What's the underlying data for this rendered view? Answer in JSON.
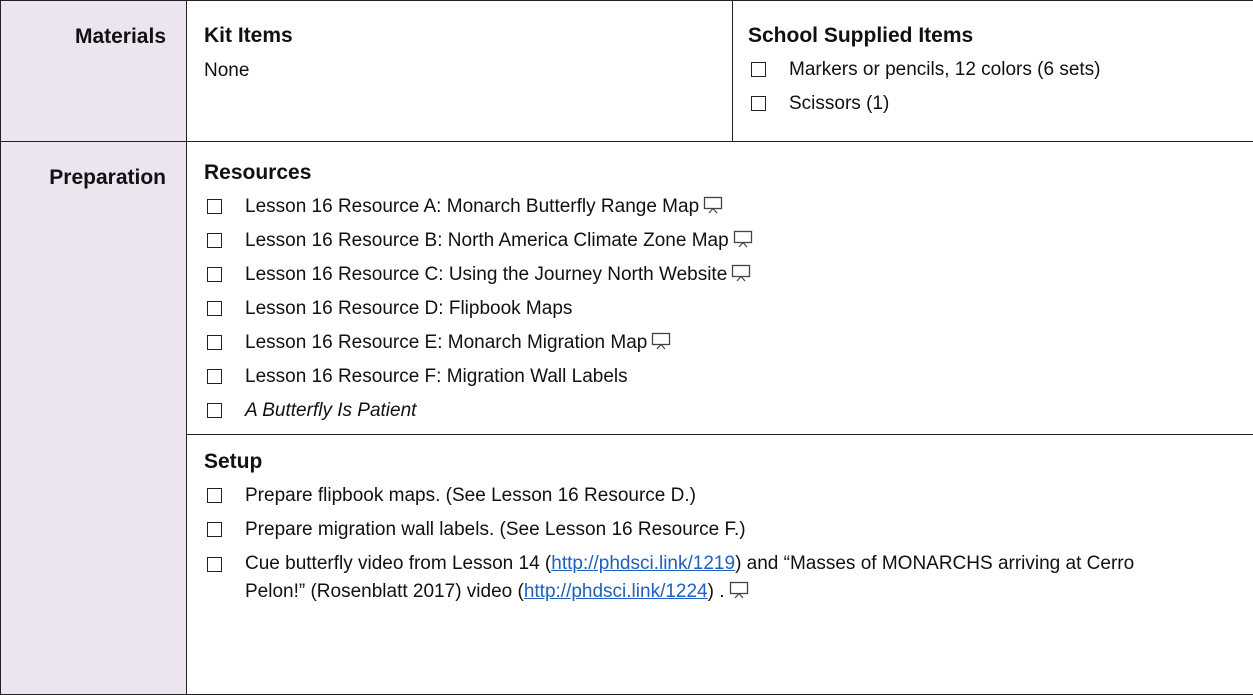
{
  "materials": {
    "label": "Materials",
    "kit_heading": "Kit Items",
    "kit_text": "None",
    "school_heading": "School Supplied Items",
    "school_items": [
      "Markers or pencils, 12 colors (6 sets)",
      "Scissors (1)"
    ]
  },
  "preparation": {
    "label": "Preparation",
    "resources_heading": "Resources",
    "resources": [
      "Lesson 16 Resource A: Monarch Butterfly Range Map",
      "Lesson 16 Resource B: North America Climate Zone Map",
      "Lesson 16 Resource C: Using the Journey North Website",
      "Lesson 16 Resource D: Flipbook Maps",
      "Lesson 16 Resource E: Monarch Migration Map",
      "Lesson 16 Resource F: Migration Wall Labels",
      "A Butterfly Is Patient"
    ],
    "setup_heading": "Setup",
    "setup": [
      "Prepare flipbook maps. (See Lesson 16 Resource D.)",
      "Prepare migration wall labels. (See Lesson 16 Resource F.)"
    ],
    "setup_last": {
      "part1": "Cue butterfly video from Lesson 14 (",
      "link1": "http://phdsci.link/1219",
      "part2": ") and “Masses of MONARCHS arriving at Cerro Pelon!” (Rosenblatt 2017) video (",
      "link2": "http://phdsci.link/1224",
      "part3": ") ."
    }
  },
  "icons": {
    "presentation": "presentation-screen-icon",
    "checkbox": "checkbox-icon"
  },
  "colors": {
    "label_background": "#ece4ef",
    "link": "#1f5fc0"
  }
}
